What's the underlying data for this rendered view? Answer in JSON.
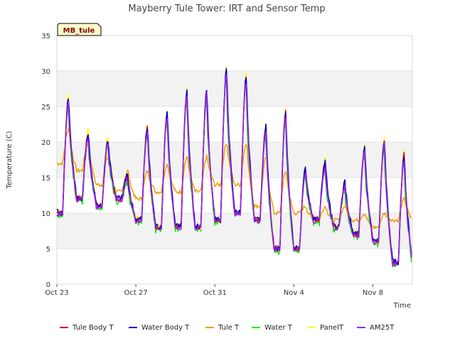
{
  "chart_data": {
    "type": "line",
    "title": "Mayberry Tule Tower: IRT and Sensor Temp",
    "xlabel": "Time",
    "ylabel": "Temperature (C)",
    "badge": "MB_tule",
    "ylim": [
      0,
      35
    ],
    "yticks": [
      0,
      5,
      10,
      15,
      20,
      25,
      30,
      35
    ],
    "xlim": [
      "2023-10-23",
      "2023-11-10"
    ],
    "xticks": [
      {
        "date": "2023-10-23",
        "label": "Oct 23"
      },
      {
        "date": "2023-10-27",
        "label": "Oct 27"
      },
      {
        "date": "2023-10-31",
        "label": "Oct 31"
      },
      {
        "date": "2023-11-04",
        "label": "Nov 4"
      },
      {
        "date": "2023-11-08",
        "label": "Nov 8"
      }
    ],
    "grid": "horizontal alternating bands",
    "legend_position": "bottom",
    "daily": {
      "dates": [
        "2023-10-23",
        "2023-10-24",
        "2023-10-25",
        "2023-10-26",
        "2023-10-27",
        "2023-10-28",
        "2023-10-29",
        "2023-10-30",
        "2023-10-31",
        "2023-11-01",
        "2023-11-02",
        "2023-11-03",
        "2023-11-04",
        "2023-11-05",
        "2023-11-06",
        "2023-11-07",
        "2023-11-08",
        "2023-11-09"
      ],
      "max_temp": [
        26,
        21,
        20,
        15,
        22,
        24,
        27,
        27,
        30,
        29,
        22,
        24,
        16,
        17,
        14,
        19,
        20,
        18
      ],
      "min_temp": [
        10,
        12,
        11,
        12,
        9,
        8,
        8,
        8,
        9,
        10,
        9,
        5,
        5,
        9,
        8,
        7,
        6,
        3
      ],
      "tule_max": [
        22,
        20,
        18,
        16,
        16,
        17,
        18,
        18,
        20,
        20,
        18,
        16,
        11,
        11,
        11,
        10,
        10,
        12
      ],
      "tule_min": [
        17,
        16,
        14,
        13,
        12,
        13,
        13,
        13,
        14,
        14,
        11,
        10,
        10,
        9,
        9,
        9,
        8,
        9
      ]
    },
    "series": [
      {
        "name": "Tule Body T",
        "color": "#dd0000"
      },
      {
        "name": "Water Body T",
        "color": "#0000cc"
      },
      {
        "name": "Tule T",
        "color": "#f0a000"
      },
      {
        "name": "Water T",
        "color": "#00ee00"
      },
      {
        "name": "PanelT",
        "color": "#ffff00"
      },
      {
        "name": "AM25T",
        "color": "#a020f0"
      }
    ]
  }
}
